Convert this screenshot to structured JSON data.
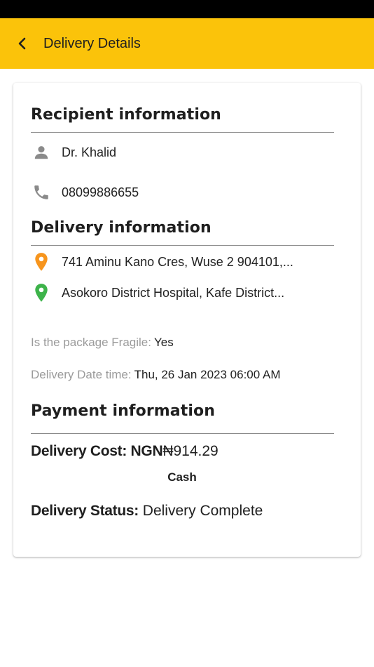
{
  "header": {
    "title": "Delivery Details"
  },
  "recipient": {
    "title": "Recipient information",
    "name": "Dr. Khalid",
    "phone": "08099886655"
  },
  "delivery": {
    "title": "Delivery information",
    "pickup": "741 Aminu Kano Cres, Wuse 2 904101,...",
    "dropoff": "Asokoro District Hospital, Kafe District...",
    "fragile_label": "Is the package Fragile:",
    "fragile_value": "Yes",
    "datetime_label": "Delivery Date time:",
    "datetime_value": "Thu, 26 Jan 2023 06:00 AM"
  },
  "payment": {
    "title": "Payment information",
    "cost_label": "Delivery Cost: NGN",
    "cost_value": "₦914.29",
    "method": "Cash",
    "status_label": "Delivery Status:",
    "status_value": "Delivery Complete"
  },
  "colors": {
    "app_bar": "#fbc30a",
    "pickup_pin": "#f7951d",
    "dropoff_pin": "#3db34a",
    "icon_gray": "#8a8a8a"
  },
  "icons": {
    "back": "arrow-back-icon",
    "person": "person-icon",
    "phone": "phone-icon",
    "pickup": "location-pin-icon",
    "dropoff": "location-pin-icon"
  }
}
